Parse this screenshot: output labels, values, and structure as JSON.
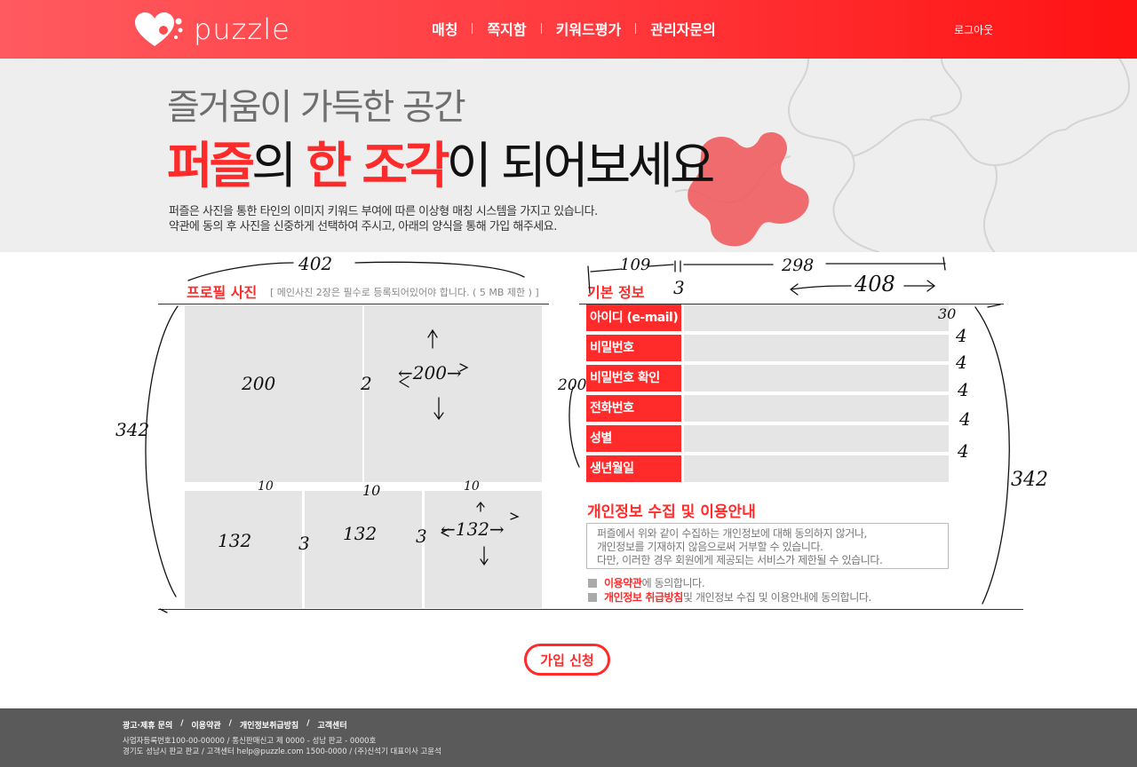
{
  "header": {
    "logo_text": "puzzle",
    "nav": [
      "매칭",
      "쪽지함",
      "키워드평가",
      "관리자문의"
    ],
    "logout": "로그아웃"
  },
  "hero": {
    "line1": "즐거움이 가득한 공간",
    "line2_a": "퍼즐",
    "line2_b": "의 ",
    "line2_c": "한 조각",
    "line2_d": "이 되어보세요",
    "desc1": "퍼즐은 사진을 통한 타인의 이미지 키워드 부여에 따른 이상형 매칭 시스템을 가지고 있습니다.",
    "desc2": "약관에 동의 후 사진을 신중하게 선택하여 주시고, 아래의 양식을 통해 가입 해주세요."
  },
  "profile": {
    "title": "프로필 사진",
    "subtitle": "[ 메인사진 2장은 필수로 등록되어있어야 합니다. ( 5 MB 제한 ) ]"
  },
  "basic": {
    "title": "기본 정보",
    "fields": [
      {
        "label": "아이디 (e-mail)",
        "value": ""
      },
      {
        "label": "비밀번호",
        "value": ""
      },
      {
        "label": "비밀번호 확인",
        "value": ""
      },
      {
        "label": "전화번호",
        "value": ""
      },
      {
        "label": "성별",
        "value": ""
      },
      {
        "label": "생년월일",
        "value": ""
      }
    ]
  },
  "privacy": {
    "title": "개인정보 수집 및 이용안내",
    "text": [
      "퍼즐에서 위와 같이 수집하는 개인정보에 대해 동의하지 않거나,",
      "개인정보를 기재하지 않음으로써 거부할 수 있습니다.",
      "다만, 이러한 경우 회원에게 제공되는 서비스가 제한될 수 있습니다."
    ],
    "agree1_link": "이용약관",
    "agree1_rest": "에 동의합니다.",
    "agree2_link": "개인정보 취급방침",
    "agree2_rest": " 및 개인정보 수집 및 이용안내에 동의합니다."
  },
  "join_button": "가입 신청",
  "annotations": {
    "w402": "402",
    "h342_left": "342",
    "big200": "200",
    "gap2": "2",
    "arrow200": "←200→",
    "gap10a": "10",
    "gap10b": "10",
    "gap10c": "10",
    "small132a": "132",
    "gap3a": "3",
    "small132b": "132",
    "gap3b": "3",
    "arrow132": "←132→",
    "w109": "109",
    "w298": "298",
    "gap3c": "3",
    "w408": "408",
    "h200_form": "200",
    "h30": "30",
    "g4a": "4",
    "g4b": "4",
    "g4c": "4",
    "g4d": "4",
    "g4e": "4",
    "h342_right": "342"
  },
  "footer": {
    "links": [
      "광고·제휴 문의",
      "이용약관",
      "개인정보취급방침",
      "고객센터"
    ],
    "line1": "사업자등록번호100-00-00000    /    통신판매신고 제 0000 - 성남 판교 - 0000호",
    "line2": "경기도 성남시 판교 판교    /    고객센터 help@puzzle.com 1500-0000    /    (주)신석기 대표이사 고윤석"
  },
  "colors": {
    "accent": "#ff2b2b",
    "field_bg": "#e5e5e5",
    "footer_bg": "#5a5a5a"
  }
}
